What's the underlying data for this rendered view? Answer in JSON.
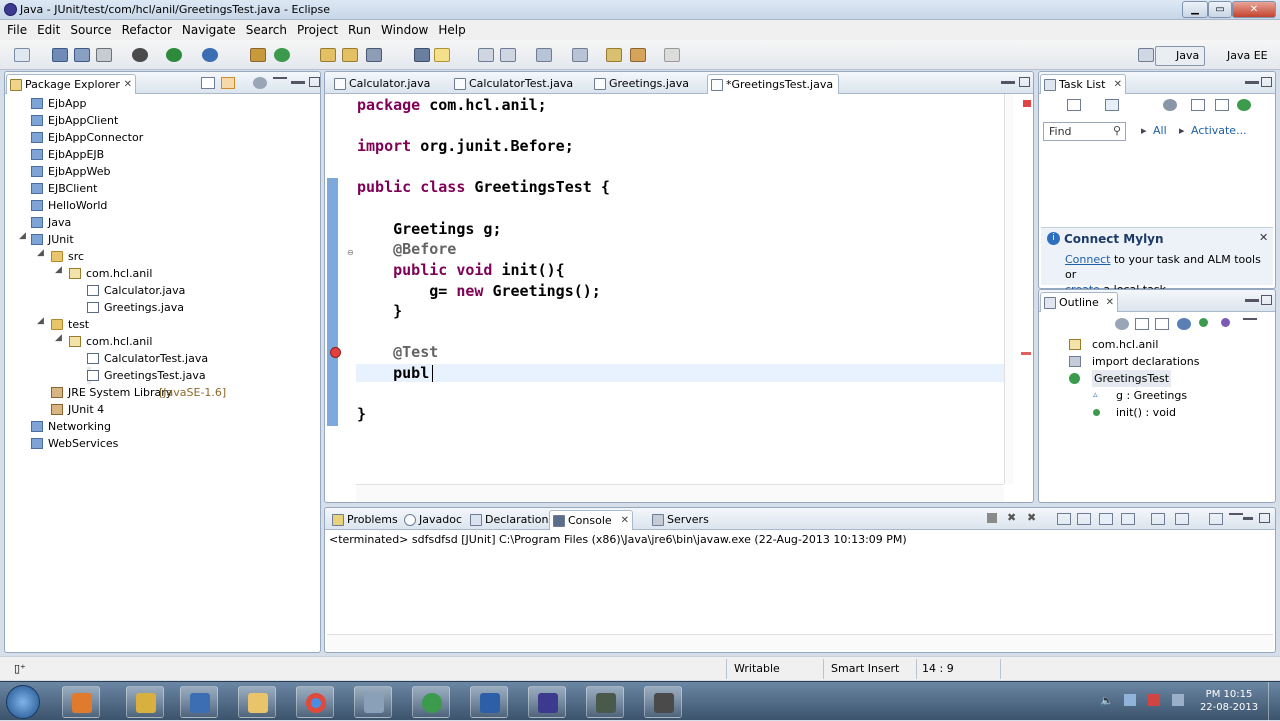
{
  "window": {
    "title": "Java - JUnit/test/com/hcl/anil/GreetingsTest.java - Eclipse",
    "min": "▁",
    "max": "▭",
    "close": "✕"
  },
  "menu": [
    "File",
    "Edit",
    "Source",
    "Refactor",
    "Navigate",
    "Search",
    "Project",
    "Run",
    "Window",
    "Help"
  ],
  "perspectives": {
    "java": "Java",
    "javaee": "Java EE"
  },
  "package_explorer": {
    "title": "Package Explorer",
    "items": [
      "EjbApp",
      "EjbAppClient",
      "EjbAppConnector",
      "EjbAppEJB",
      "EjbAppWeb",
      "EJBClient",
      "HelloWorld",
      "Java",
      "JUnit",
      "src",
      "com.hcl.anil",
      "Calculator.java",
      "Greetings.java",
      "test",
      "com.hcl.anil",
      "CalculatorTest.java",
      "GreetingsTest.java",
      "JRE System Library",
      "[JavaSE-1.6]",
      "JUnit 4",
      "Networking",
      "WebServices"
    ]
  },
  "editor": {
    "tabs": [
      "Calculator.java",
      "CalculatorTest.java",
      "Greetings.java",
      "*GreetingsTest.java"
    ],
    "code": {
      "l1_kw": "package",
      "l1_rest": " com.hcl.anil;",
      "l2_kw": "import",
      "l2_rest": " org.junit.Before;",
      "l3_kw": "public class",
      "l3_rest": " GreetingsTest {",
      "l4": "    Greetings g;",
      "l5": "    @Before",
      "l6_kw": "    public void",
      "l6_rest": " init(){",
      "l7_a": "        g= ",
      "l7_kw": "new",
      "l7_b": " Greetings();",
      "l8": "    }",
      "l9": "    @Test",
      "l10": "    publ",
      "l11": "}"
    }
  },
  "task_list": {
    "title": "Task List",
    "find_placeholder": "Find",
    "all": "All",
    "activate": "Activate..."
  },
  "mylyn": {
    "title": "Connect Mylyn",
    "connect": "Connect",
    "text1": " to your task and ALM tools or",
    "create": "create",
    "text2": " a local task."
  },
  "outline": {
    "title": "Outline",
    "items": [
      "com.hcl.anil",
      "import declarations",
      "GreetingsTest",
      "g : Greetings",
      "init() : void"
    ]
  },
  "bottom_tabs": [
    "Problems",
    "Javadoc",
    "Declaration",
    "Console",
    "Servers"
  ],
  "console": {
    "text": "<terminated> sdfsdfsd [JUnit] C:\\Program Files (x86)\\Java\\jre6\\bin\\javaw.exe (22-Aug-2013 10:13:09 PM)"
  },
  "status": {
    "writable": "Writable",
    "insert": "Smart Insert",
    "pos": "14 : 9"
  },
  "clock": {
    "time": "PM 10:15",
    "date": "22-08-2013"
  }
}
